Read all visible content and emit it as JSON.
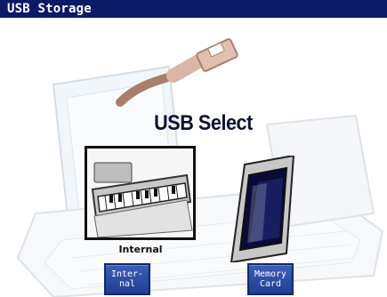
{
  "window": {
    "title": "USB Storage"
  },
  "main": {
    "heading": "USB Select",
    "options": {
      "internal_label": "Internal"
    }
  },
  "buttons": {
    "internal": "Inter-\nnal",
    "memory_card": "Memory\nCard"
  },
  "icons": {
    "usb_cable": "usb-cable-icon",
    "internal_keyboard": "keyboard-icon",
    "memory_card": "memory-card-icon"
  },
  "colors": {
    "titlebar_bg": "#0b1a66",
    "button_bg": "#1e3f93",
    "button_border": "#0f2a6d",
    "title_text": "#0e1230"
  }
}
